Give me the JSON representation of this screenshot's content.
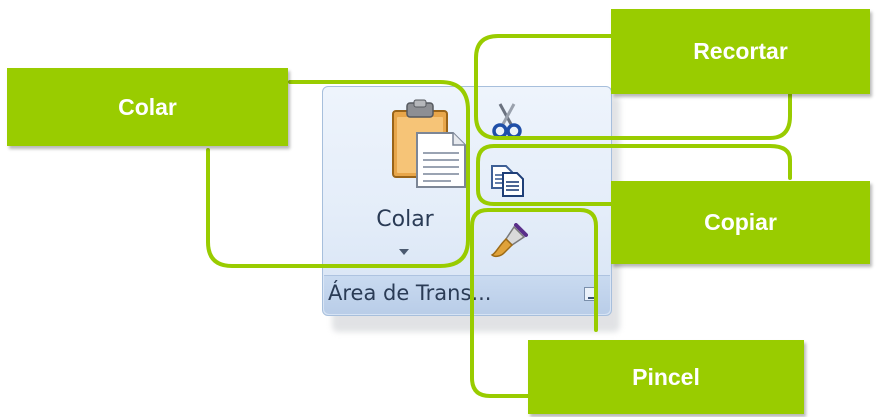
{
  "ribbon": {
    "group_title": "Área de Trans...",
    "paste_label": "Colar",
    "buttons": [
      {
        "id": "paste",
        "icon": "clipboard-paste-icon"
      },
      {
        "id": "cut",
        "icon": "scissors-icon"
      },
      {
        "id": "copy",
        "icon": "copy-documents-icon"
      },
      {
        "id": "format_painter",
        "icon": "paintbrush-icon"
      },
      {
        "id": "dialog_launcher",
        "icon": "dialog-launcher-icon"
      }
    ]
  },
  "callouts": {
    "colar": "Colar",
    "recortar": "Recortar",
    "copiar": "Copiar",
    "pincel": "Pincel"
  },
  "colors": {
    "callout": "#99cc00",
    "connector": "#99cc00",
    "ribbon_bg": "#e4edf9",
    "ribbon_border": "#a7bfdc"
  }
}
